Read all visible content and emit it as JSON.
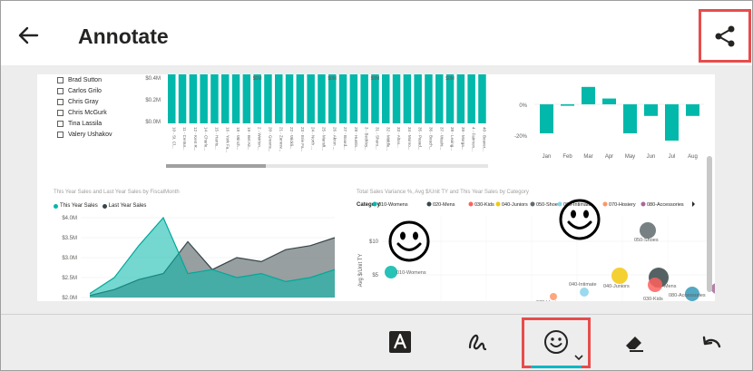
{
  "header": {
    "title": "Annotate"
  },
  "icons": {
    "back": "arrow-left-icon",
    "share": "share-icon",
    "text": "text-box-icon",
    "pen": "pen-scribble-icon",
    "stamp": "smiley-icon",
    "eraser": "eraser-icon",
    "undo": "undo-icon"
  },
  "colors": {
    "accent": "#00b7c3",
    "highlight": "#e74c4c",
    "teal": "#01b8aa",
    "dark": "#374649"
  },
  "slicer": {
    "items": [
      "Brad Sutton",
      "Carlos Grilo",
      "Chris Gray",
      "Chris McGurk",
      "Tina Lassila",
      "Valery Ushakov"
    ]
  },
  "bar_chart": {
    "y_ticks": [
      "$0.4M",
      "$0.2M",
      "$0.0M"
    ],
    "value_label": "$0M",
    "categories": [
      "10 - St. Cl...",
      "11 - Centur...",
      "12 - Kent R...",
      "14 - Charle...",
      "15 - Harris...",
      "16 - York Fa...",
      "18 - Winch...",
      "19 - Bel Air...",
      "2 - Weirton...",
      "20 - Greens...",
      "21 - Zanesv...",
      "22 - Wickli...",
      "23 - Erie Fa...",
      "24 - North ...",
      "25 - Mansfi...",
      "26 - Akron ...",
      "27 - Board...",
      "28 - Huntin...",
      "3 - Beckley...",
      "31 - Sharo...",
      "32 - Middle...",
      "33 - Altoo...",
      "34 - Monro...",
      "35 - Pasad...",
      "36 - Beach...",
      "37 - Washi...",
      "38 - Lexing...",
      "39 - Morga...",
      "4 - Fairmon...",
      "40 - Beaver..."
    ],
    "values": [
      0.48,
      0.5,
      0.49,
      0.48,
      0.5,
      0.47,
      0.48,
      0.46,
      0.5,
      0.49,
      0.47,
      0.5,
      0.48,
      0.5,
      0.49,
      0.45,
      0.48,
      0.5,
      0.47,
      0.49,
      0.5,
      0.48,
      0.47,
      0.46,
      0.5,
      0.49,
      0.48,
      0.5,
      0.47,
      0.49
    ]
  },
  "variance_chart": {
    "y_ticks": [
      "0%",
      "-20%"
    ],
    "months": [
      "Jan",
      "Feb",
      "Mar",
      "Apr",
      "May",
      "Jun",
      "Jul",
      "Aug"
    ],
    "values": [
      -20,
      -1,
      12,
      4,
      -20,
      -8,
      -25,
      -8
    ]
  },
  "line_chart": {
    "title": "This Year Sales and Last Year Sales by FiscalMonth",
    "legend": [
      "This Year Sales",
      "Last Year Sales"
    ],
    "y_ticks": [
      "$4.0M",
      "$3.5M",
      "$3.0M",
      "$2.5M",
      "$2.0M"
    ],
    "this_year": [
      2.1,
      2.5,
      3.3,
      4.0,
      2.6,
      2.7,
      2.5,
      2.6,
      2.4,
      2.5,
      2.7
    ],
    "last_year": [
      2.05,
      2.2,
      2.45,
      2.6,
      3.4,
      2.7,
      3.0,
      2.9,
      3.2,
      3.3,
      3.5
    ]
  },
  "scatter_chart": {
    "title": "Total Sales Variance %, Avg $/Unit TY and This Year Sales by Category",
    "legend_label": "Category",
    "legend": [
      "010-Womens",
      "020-Mens",
      "030-Kids",
      "040-Juniors",
      "050-Shoes",
      "060-Intimate",
      "070-Hosiery",
      "080-Accessories"
    ],
    "y_axis_label": "Avg $/Unit TY",
    "y_ticks": [
      "$10",
      "$5"
    ],
    "point_labels": [
      "010-Womens",
      "050-Shoes",
      "040-Intimate",
      "040-Juniors",
      "020-Mens",
      "030-Kids",
      "080-Accessories",
      "070-Hosiery",
      "080-Home"
    ]
  }
}
